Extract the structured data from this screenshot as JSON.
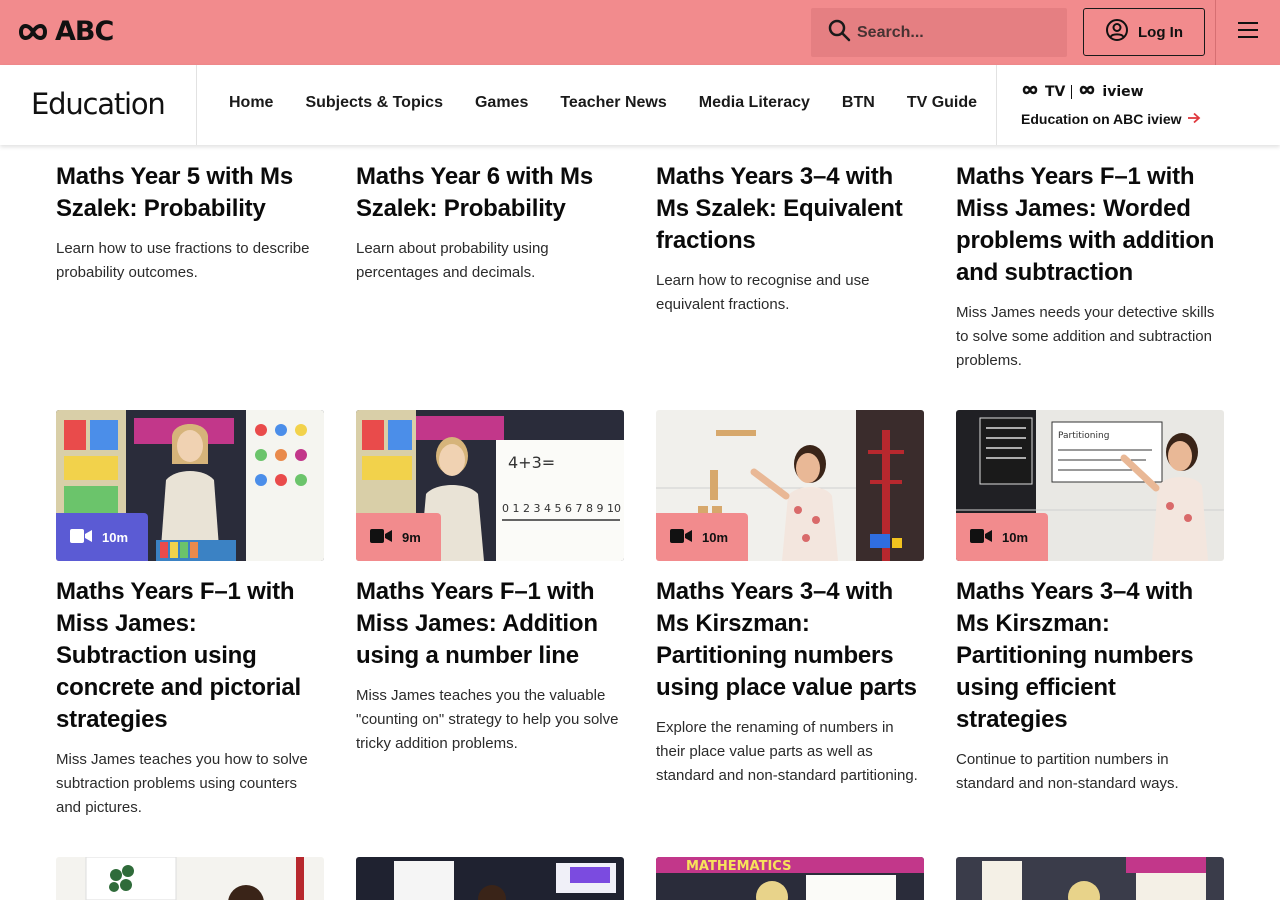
{
  "header": {
    "logo_text": "ABC",
    "search_placeholder": "Search...",
    "login_label": "Log In"
  },
  "nav": {
    "section_title": "Education",
    "links": [
      "Home",
      "Subjects & Topics",
      "Games",
      "Teacher News",
      "Media Literacy",
      "BTN",
      "TV Guide"
    ],
    "iview_logo_tv": "TV",
    "iview_logo_iview": "iview",
    "iview_link": "Education on ABC iview"
  },
  "colors": {
    "brand": "#f28b8d",
    "badge_active": "#5b5bd4"
  },
  "cards_row1": [
    {
      "title": "Maths Year 5 with Ms Szalek: Probability",
      "desc": "Learn how to use fractions to describe probability outcomes."
    },
    {
      "title": "Maths Year 6 with Ms Szalek: Probability",
      "desc": "Learn about probability using percentages and decimals."
    },
    {
      "title": "Maths Years 3–4 with Ms Szalek: Equivalent fractions",
      "desc": "Learn how to recognise and use equivalent fractions."
    },
    {
      "title": "Maths Years F–1 with Miss James: Worded problems with addition and subtraction",
      "desc": "Miss James needs your detective skills to solve some addition and subtraction problems."
    }
  ],
  "cards_row2": [
    {
      "duration": "10m",
      "title": "Maths Years F–1 with Miss James: Subtraction using concrete and pictorial strategies",
      "desc": "Miss James teaches you how to solve subtraction problems using counters and pictures."
    },
    {
      "duration": "9m",
      "title": "Maths Years F–1 with Miss James: Addition using a number line",
      "desc": "Miss James teaches you the valuable \"counting on\" strategy to help you solve tricky addition problems."
    },
    {
      "duration": "10m",
      "title": "Maths Years 3–4 with Ms Kirszman: Partitioning numbers using place value parts",
      "desc": "Explore the renaming of numbers in their place value parts as well as standard and non-standard partitioning."
    },
    {
      "duration": "10m",
      "title": "Maths Years 3–4 with Ms Kirszman: Partitioning numbers using efficient strategies",
      "desc": "Continue to partition numbers in standard and non-standard ways."
    }
  ],
  "thumb_text": {
    "whiteboard_sum": "4+3=",
    "number_line": "0 1 2 3 4 5 6 7 8 9 10",
    "board_heading": "Partitioning",
    "banner": "MATHEMATICS"
  }
}
